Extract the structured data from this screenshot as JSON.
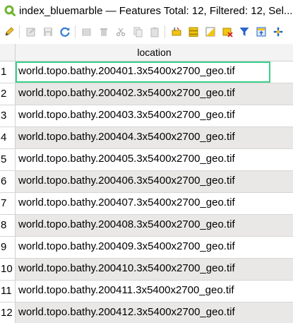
{
  "window": {
    "title": "index_bluemarble — Features Total: 12, Filtered: 12, Sel..."
  },
  "toolbar": {
    "buttons": [
      {
        "name": "toggle-editing-icon",
        "color": "#d4a21a"
      },
      {
        "name": "multi-edit-icon",
        "color": "#b7b7b7"
      },
      {
        "name": "save-edits-icon",
        "color": "#b7b7b7"
      },
      {
        "name": "reload-icon",
        "color": "#2e7bd6"
      },
      {
        "name": "add-feature-icon",
        "color": "#b7b7b7"
      },
      {
        "name": "delete-icon",
        "color": "#b7b7b7"
      },
      {
        "name": "cut-icon",
        "color": "#b7b7b7"
      },
      {
        "name": "copy-icon",
        "color": "#b7b7b7"
      },
      {
        "name": "paste-icon",
        "color": "#b7b7b7"
      },
      {
        "name": "select-expression-icon",
        "color": "#e8b800"
      },
      {
        "name": "select-all-icon",
        "color": "#e8b800"
      },
      {
        "name": "invert-selection-icon",
        "color": "#e8b800"
      },
      {
        "name": "deselect-all-icon",
        "color": "#e8b800"
      },
      {
        "name": "filter-icon",
        "color": "#2a66c8"
      },
      {
        "name": "move-selection-top-icon",
        "color": "#2a66c8"
      },
      {
        "name": "pan-to-selected-icon",
        "color": "#2a66c8"
      }
    ]
  },
  "table": {
    "column_header": "location",
    "rows": [
      {
        "num": "1",
        "location": "world.topo.bathy.200401.3x5400x2700_geo.tif"
      },
      {
        "num": "2",
        "location": "world.topo.bathy.200402.3x5400x2700_geo.tif"
      },
      {
        "num": "3",
        "location": "world.topo.bathy.200403.3x5400x2700_geo.tif"
      },
      {
        "num": "4",
        "location": "world.topo.bathy.200404.3x5400x2700_geo.tif"
      },
      {
        "num": "5",
        "location": "world.topo.bathy.200405.3x5400x2700_geo.tif"
      },
      {
        "num": "6",
        "location": "world.topo.bathy.200406.3x5400x2700_geo.tif"
      },
      {
        "num": "7",
        "location": "world.topo.bathy.200407.3x5400x2700_geo.tif"
      },
      {
        "num": "8",
        "location": "world.topo.bathy.200408.3x5400x2700_geo.tif"
      },
      {
        "num": "9",
        "location": "world.topo.bathy.200409.3x5400x2700_geo.tif"
      },
      {
        "num": "10",
        "location": "world.topo.bathy.200410.3x5400x2700_geo.tif"
      },
      {
        "num": "11",
        "location": "world.topo.bathy.200411.3x5400x2700_geo.tif"
      },
      {
        "num": "12",
        "location": "world.topo.bathy.200412.3x5400x2700_geo.tif"
      }
    ]
  },
  "colors": {
    "selected_border": "#3ad08a",
    "alt_row": "#e9e8e6",
    "qgis_green": "#6fb432"
  }
}
